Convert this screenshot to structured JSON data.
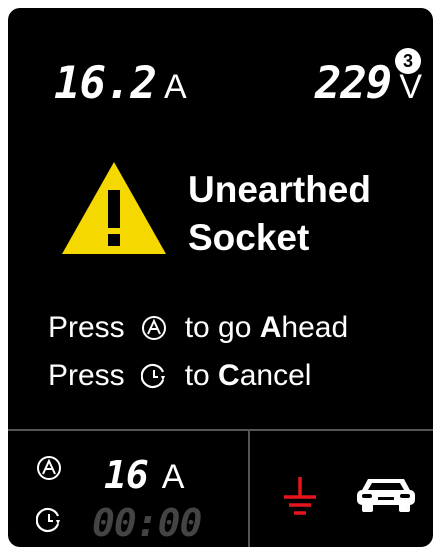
{
  "readings": {
    "current": "16.2",
    "current_unit": "A",
    "voltage": "229",
    "voltage_unit": "V",
    "badge": "3"
  },
  "alert": {
    "line1": "Unearthed",
    "line2": "Socket",
    "icon": "warning-triangle-icon",
    "color": "#f5d800"
  },
  "instructions": {
    "row1_press": "Press",
    "row1_tail_pre": "to go ",
    "row1_tail_bold": "A",
    "row1_tail_post": "head",
    "row2_press": "Press",
    "row2_tail_pre": "to ",
    "row2_tail_bold": "C",
    "row2_tail_post": "ancel"
  },
  "status": {
    "set_current": "16",
    "set_current_unit": "A",
    "timer": "00:00",
    "earth_color": "#e8141c",
    "icons": [
      "auto-icon",
      "timer-icon",
      "earth-fault-icon",
      "car-icon"
    ]
  }
}
